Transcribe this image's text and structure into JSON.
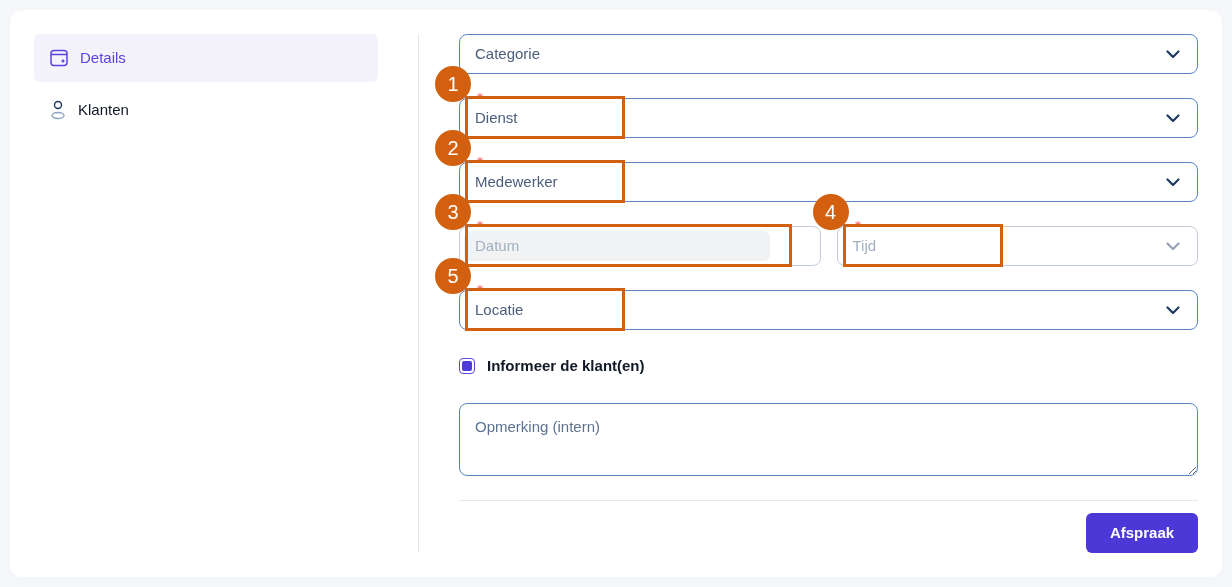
{
  "sidebar": {
    "items": [
      {
        "label": "Details",
        "kind": "calendar",
        "selected": true
      },
      {
        "label": "Klanten",
        "kind": "person",
        "selected": false
      }
    ]
  },
  "form": {
    "rows": [
      {
        "fields": [
          {
            "kind": "select",
            "placeholder": "Categorie",
            "required": false,
            "disabled": false
          }
        ]
      },
      {
        "fields": [
          {
            "kind": "select",
            "placeholder": "Dienst",
            "required": true,
            "disabled": false,
            "callout": "1"
          }
        ]
      },
      {
        "fields": [
          {
            "kind": "select",
            "placeholder": "Medewerker",
            "required": true,
            "disabled": false,
            "callout": "2"
          }
        ]
      },
      {
        "fields": [
          {
            "kind": "date",
            "placeholder": "Datum",
            "required": true,
            "disabled": true,
            "callout": "3"
          },
          {
            "kind": "select",
            "placeholder": "Tijd",
            "required": true,
            "disabled": true,
            "callout": "4"
          }
        ]
      },
      {
        "fields": [
          {
            "kind": "select",
            "placeholder": "Locatie",
            "required": true,
            "disabled": false,
            "callout": "5"
          }
        ]
      }
    ],
    "checkbox": {
      "label": "Informeer de klant(en)",
      "checked": true
    },
    "note": {
      "placeholder": "Opmerking (intern)"
    },
    "submit": "Afspraak"
  }
}
